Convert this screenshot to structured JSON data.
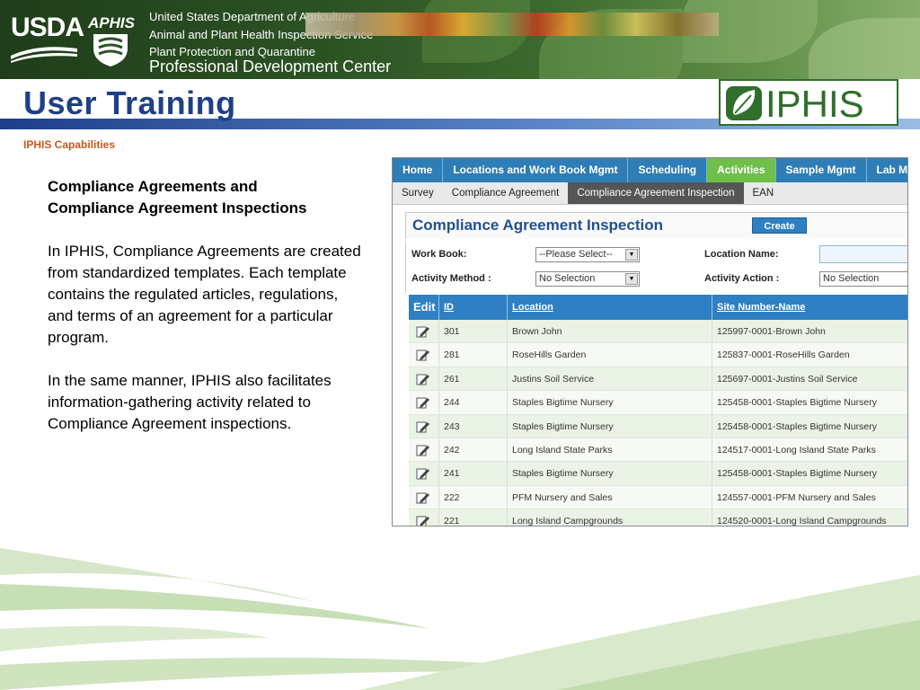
{
  "header": {
    "usda_logo_text": "USDA",
    "aphis_logo_text": "APHIS",
    "org_line_1": "United States Department of Agriculture",
    "org_line_2": "Animal and Plant Health Inspection Service",
    "org_line_3": "Plant Protection and Quarantine",
    "org_line_4": "Professional Development Center"
  },
  "strip": {
    "title": "User Training",
    "brand": "IPHIS",
    "section_label": "IPHIS Capabilities"
  },
  "content": {
    "heading_line_1": "Compliance Agreements and",
    "heading_line_2": "Compliance Agreement Inspections",
    "paragraph_1": "In IPHIS, Compliance Agreements are created from standardized templates. Each template contains the regulated articles, regulations, and terms of an agreement for a particular program.",
    "paragraph_2": "In the same manner, IPHIS also facilitates information-gathering activity related to Compliance Agreement inspections."
  },
  "app": {
    "top_tabs": [
      {
        "label": "Home"
      },
      {
        "label": "Locations and Work Book Mgmt"
      },
      {
        "label": "Scheduling"
      },
      {
        "label": "Activities"
      },
      {
        "label": "Sample Mgmt"
      },
      {
        "label": "Lab Mgmt"
      }
    ],
    "sub_tabs": [
      {
        "label": "Survey"
      },
      {
        "label": "Compliance Agreement"
      },
      {
        "label": "Compliance Agreement Inspection"
      },
      {
        "label": "EAN"
      }
    ],
    "page_title": "Compliance Agreement Inspection",
    "create_label": "Create",
    "filters": {
      "work_book_label": "Work Book:",
      "work_book_value": "--Please Select--",
      "location_name_label": "Location Name:",
      "location_name_value": "",
      "activity_method_label": "Activity Method :",
      "activity_method_value": "No Selection",
      "activity_action_label": "Activity Action :",
      "activity_action_value": "No Selection"
    },
    "grid": {
      "columns": {
        "edit": "Edit",
        "id": "ID",
        "location": "Location",
        "site": "Site Number-Name"
      },
      "rows": [
        {
          "id": "301",
          "location": "Brown John",
          "site": "125997-0001-Brown John"
        },
        {
          "id": "281",
          "location": "RoseHills Garden",
          "site": "125837-0001-RoseHills Garden"
        },
        {
          "id": "261",
          "location": "Justins Soil Service",
          "site": "125697-0001-Justins Soil Service"
        },
        {
          "id": "244",
          "location": "Staples Bigtime Nursery",
          "site": "125458-0001-Staples Bigtime Nursery"
        },
        {
          "id": "243",
          "location": "Staples Bigtime Nursery",
          "site": "125458-0001-Staples Bigtime Nursery"
        },
        {
          "id": "242",
          "location": "Long Island State Parks",
          "site": "124517-0001-Long Island State Parks"
        },
        {
          "id": "241",
          "location": "Staples Bigtime Nursery",
          "site": "125458-0001-Staples Bigtime Nursery"
        },
        {
          "id": "222",
          "location": "PFM Nursery and Sales",
          "site": "124557-0001-PFM Nursery and Sales"
        },
        {
          "id": "221",
          "location": "Long Island Campgrounds",
          "site": "124520-0001-Long Island Campgrounds"
        }
      ]
    }
  },
  "colors": {
    "banner_green": "#2c5224",
    "title_blue": "#1f3f86",
    "section_orange": "#c8581b",
    "nav_blue": "#2e7db6",
    "nav_active_green": "#6fbf4a",
    "iphis_green": "#2f6f2b"
  },
  "icons": {
    "edit": "edit-pencil-icon",
    "iphis_logo": "leaf-icon",
    "aphis_logo": "shield-icon",
    "dropdown": "chevron-down-icon"
  }
}
